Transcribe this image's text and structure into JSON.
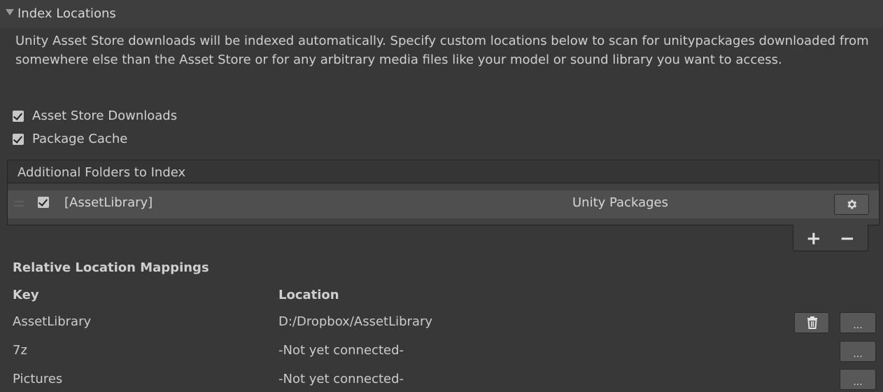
{
  "section": {
    "title": "Index Locations",
    "description": "Unity Asset Store downloads will be indexed automatically. Specify custom locations below to scan for unitypackages downloaded from somewhere else than the Asset Store or for any arbitrary media files like your model or sound library you want to access."
  },
  "options": {
    "asset_store_downloads": {
      "label": "Asset Store Downloads",
      "checked": true
    },
    "package_cache": {
      "label": "Package Cache",
      "checked": true
    }
  },
  "folders": {
    "header": "Additional Folders to Index",
    "items": [
      {
        "path": "[AssetLibrary]",
        "type": "Unity Packages",
        "enabled": true
      }
    ],
    "add_label": "+",
    "remove_label": "−"
  },
  "mappings": {
    "title": "Relative Location Mappings",
    "columns": {
      "key": "Key",
      "location": "Location"
    },
    "rows": [
      {
        "key": "AssetLibrary",
        "location": "D:/Dropbox/AssetLibrary",
        "browse_label": "..."
      },
      {
        "key": "7z",
        "location": "-Not yet connected-",
        "browse_label": "..."
      },
      {
        "key": "Pictures",
        "location": "-Not yet connected-",
        "browse_label": "..."
      }
    ]
  },
  "icons": {
    "foldout": "triangle-down-icon",
    "settings": "gear-icon",
    "delete": "trash-icon"
  },
  "colors": {
    "background": "#383838",
    "row_highlight": "#4f4f4f",
    "button": "#585858",
    "text": "#d2d2d2"
  }
}
